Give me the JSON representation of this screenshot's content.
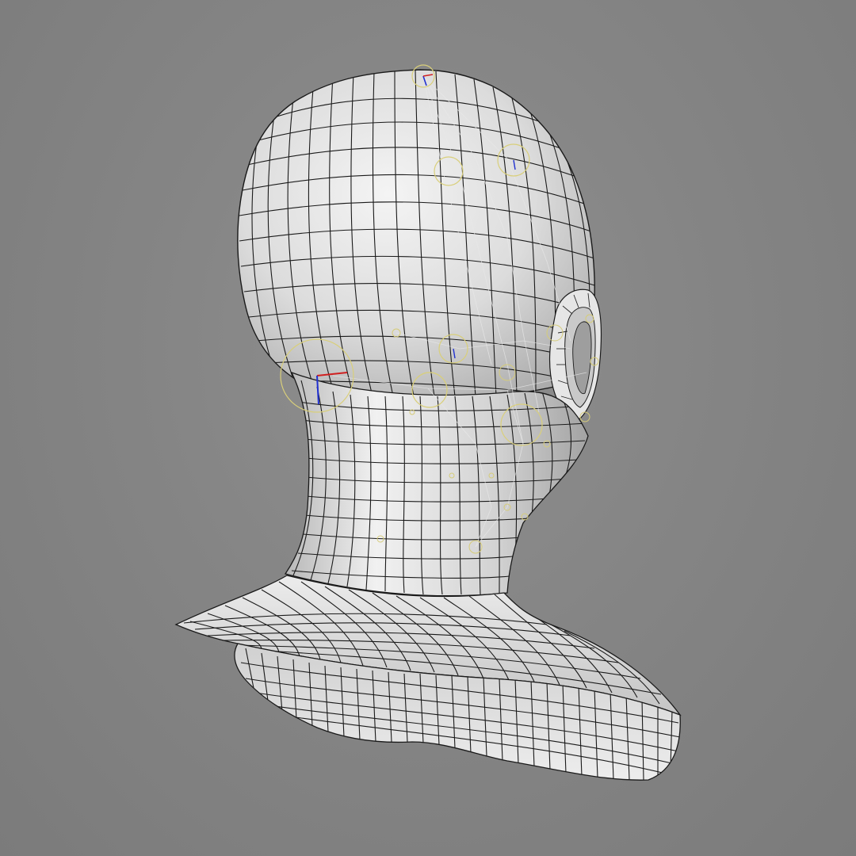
{
  "viewport": {
    "background_color": "#858585",
    "mesh_fill_color": "#d8d8d8",
    "wire_color": "#1a1a1a",
    "rig_control_color": "#d9cf7a",
    "axis_colors": {
      "x": "#d02020",
      "z": "#2030d0"
    },
    "subject": "wireframe-head-mesh"
  }
}
